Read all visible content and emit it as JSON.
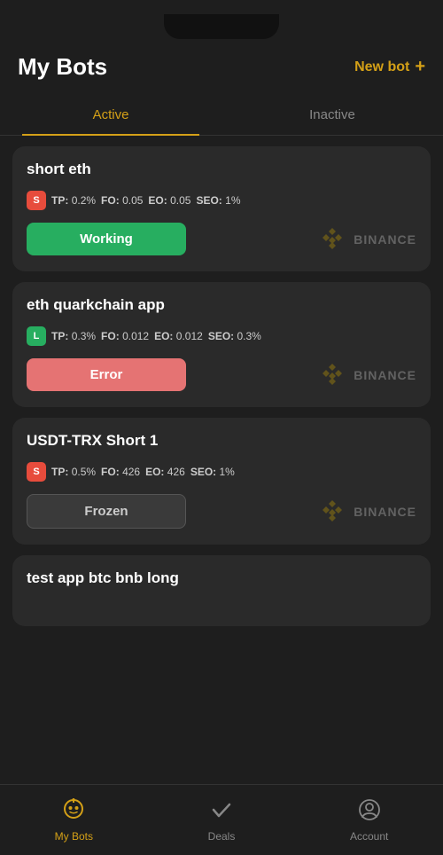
{
  "header": {
    "title": "My Bots",
    "new_bot_label": "New bot",
    "new_bot_icon": "+"
  },
  "tabs": [
    {
      "label": "Active",
      "active": true
    },
    {
      "label": "Inactive",
      "active": false
    }
  ],
  "bots": [
    {
      "name": "short eth",
      "badge": "S",
      "badge_type": "s",
      "tp": "0.2%",
      "fo": "0.05",
      "eo": "0.05",
      "seo": "1%",
      "status": "Working",
      "status_type": "working",
      "exchange": "BINANCE"
    },
    {
      "name": "eth quarkchain app",
      "badge": "L",
      "badge_type": "l",
      "tp": "0.3%",
      "fo": "0.012",
      "eo": "0.012",
      "seo": "0.3%",
      "status": "Error",
      "status_type": "error",
      "exchange": "BINANCE"
    },
    {
      "name": "USDT-TRX Short 1",
      "badge": "S",
      "badge_type": "s",
      "tp": "0.5%",
      "fo": "426",
      "eo": "426",
      "seo": "1%",
      "status": "Frozen",
      "status_type": "frozen",
      "exchange": "BINANCE"
    },
    {
      "name": "test app btc bnb long",
      "badge": null,
      "badge_type": null,
      "tp": null,
      "fo": null,
      "eo": null,
      "seo": null,
      "status": null,
      "status_type": null,
      "exchange": null
    }
  ],
  "nav": [
    {
      "label": "My Bots",
      "icon": "robot",
      "active": true
    },
    {
      "label": "Deals",
      "icon": "check",
      "active": false
    },
    {
      "label": "Account",
      "icon": "account",
      "active": false
    }
  ],
  "params_labels": {
    "tp": "TP:",
    "fo": "FO:",
    "eo": "EO:",
    "seo": "SEO:"
  }
}
